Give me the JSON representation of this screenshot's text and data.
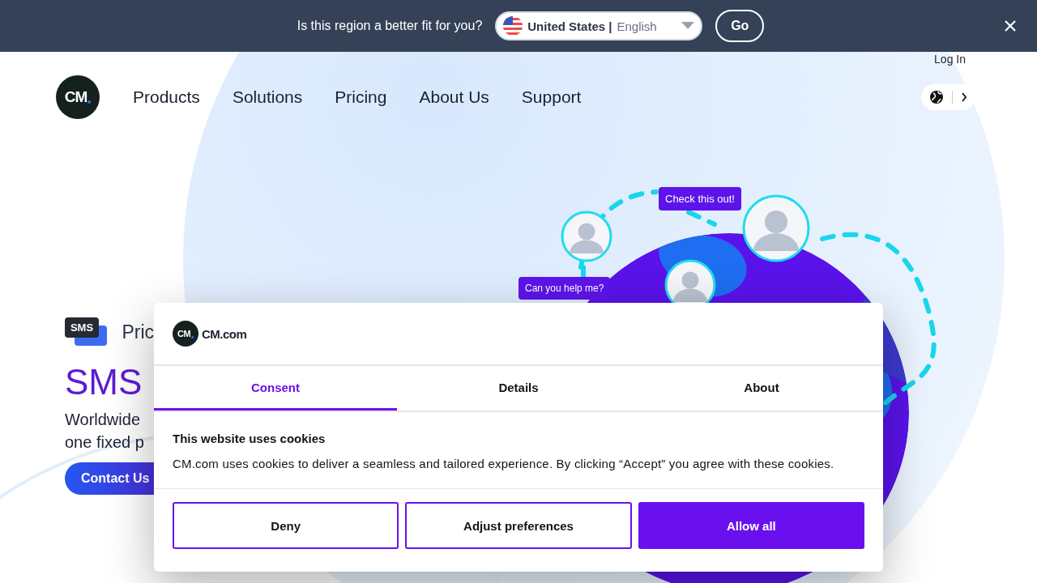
{
  "banner": {
    "question": "Is this region a better fit for you?",
    "region": {
      "country": "United States |",
      "language": "English"
    },
    "go_button": "Go"
  },
  "header": {
    "logo": "CM",
    "login": "Log In",
    "nav": [
      "Products",
      "Solutions",
      "Pricing",
      "About Us",
      "Support"
    ]
  },
  "hero": {
    "product_label": "Pric",
    "sms_icon": "SMS",
    "title": "SMS",
    "subtitle_lines": [
      "Worldwide",
      "one fixed p"
    ],
    "cta": "Contact Us"
  },
  "illustration": {
    "bubbles": [
      {
        "text": "Check this out!",
        "kind": "top"
      },
      {
        "text": "Can you help me?",
        "kind": "left"
      }
    ]
  },
  "cookie_dialog": {
    "logo": "CM",
    "brand": "CM.com",
    "tabs": [
      {
        "label": "Consent",
        "selected": true
      },
      {
        "label": "Details",
        "selected": false
      },
      {
        "label": "About",
        "selected": false
      }
    ],
    "heading": "This website uses cookies",
    "body": "CM.com uses cookies to deliver a seamless and tailored experience. By clicking “Accept” you agree with these cookies.",
    "buttons": [
      {
        "label": "Deny",
        "kind": "outline"
      },
      {
        "label": "Adjust preferences",
        "kind": "outline"
      },
      {
        "label": "Allow all",
        "kind": "filled"
      }
    ]
  }
}
